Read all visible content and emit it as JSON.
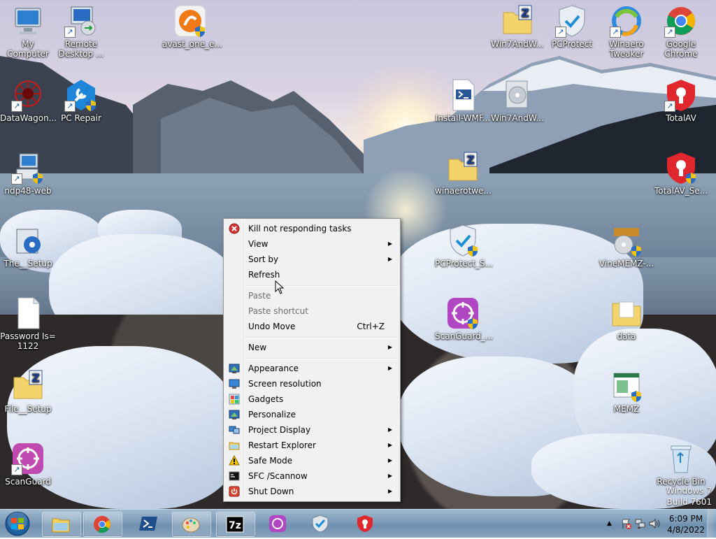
{
  "desktop": {
    "icons": [
      {
        "label": "My Computer"
      },
      {
        "label": "Remote Desktop ..."
      },
      {
        "label": "avast_one_e..."
      },
      {
        "label": "Win7AndW..."
      },
      {
        "label": "PCProtect"
      },
      {
        "label": "Winaero Tweaker"
      },
      {
        "label": "Google Chrome"
      },
      {
        "label": "DataWagon..."
      },
      {
        "label": "PC Repair"
      },
      {
        "label": "Install-WMF..."
      },
      {
        "label": "Win7AndW..."
      },
      {
        "label": "TotalAV"
      },
      {
        "label": "ndp48-web"
      },
      {
        "label": "winaerotwe..."
      },
      {
        "label": "TotalAV_Se..."
      },
      {
        "label": "The__Setup"
      },
      {
        "label": "PCProtect_S..."
      },
      {
        "label": "VineMEMZ-..."
      },
      {
        "label": "Password Is= 1122"
      },
      {
        "label": "ScanGuard_..."
      },
      {
        "label": "data"
      },
      {
        "label": "File__Setup"
      },
      {
        "label": "MEMZ"
      },
      {
        "label": "ScanGuard"
      },
      {
        "label": "Recycle Bin"
      }
    ],
    "watermark": {
      "line1": "Windows 7",
      "line2": "Build 7601"
    }
  },
  "context_menu": {
    "items": [
      {
        "label": "Kill not responding tasks",
        "icon": "kill-icon",
        "disabled": false
      },
      {
        "label": "View",
        "submenu": true
      },
      {
        "label": "Sort by",
        "submenu": true
      },
      {
        "label": "Refresh"
      },
      {
        "label": "Paste",
        "disabled": true
      },
      {
        "label": "Paste shortcut",
        "disabled": true
      },
      {
        "label": "Undo Move",
        "shortcut": "Ctrl+Z"
      },
      {
        "label": "New",
        "submenu": true
      },
      {
        "label": "Appearance",
        "icon": "appearance-icon",
        "submenu": true
      },
      {
        "label": "Screen resolution",
        "icon": "screen-resolution-icon"
      },
      {
        "label": "Gadgets",
        "icon": "gadgets-icon"
      },
      {
        "label": "Personalize",
        "icon": "personalize-icon"
      },
      {
        "label": "Project Display",
        "icon": "project-display-icon",
        "submenu": true
      },
      {
        "label": "Restart Explorer",
        "icon": "folder-icon",
        "submenu": true
      },
      {
        "label": "Safe Mode",
        "icon": "warning-icon",
        "submenu": true
      },
      {
        "label": "SFC /Scannow",
        "icon": "cmd-icon",
        "submenu": true
      },
      {
        "label": "Shut Down",
        "icon": "power-icon",
        "submenu": true
      }
    ]
  },
  "taskbar": {
    "pinned": [
      "Windows Explorer",
      "Google Chrome",
      "PowerShell",
      "Paint",
      "7-Zip",
      "ScanGuard",
      "PCProtect",
      "TotalAV"
    ],
    "clock": {
      "time": "6:09 PM",
      "date": "4/8/2022"
    }
  },
  "colors": {
    "taskbar": "#7c9bb8",
    "menu_bg": "#f1f1f1",
    "menu_border": "#979797"
  }
}
